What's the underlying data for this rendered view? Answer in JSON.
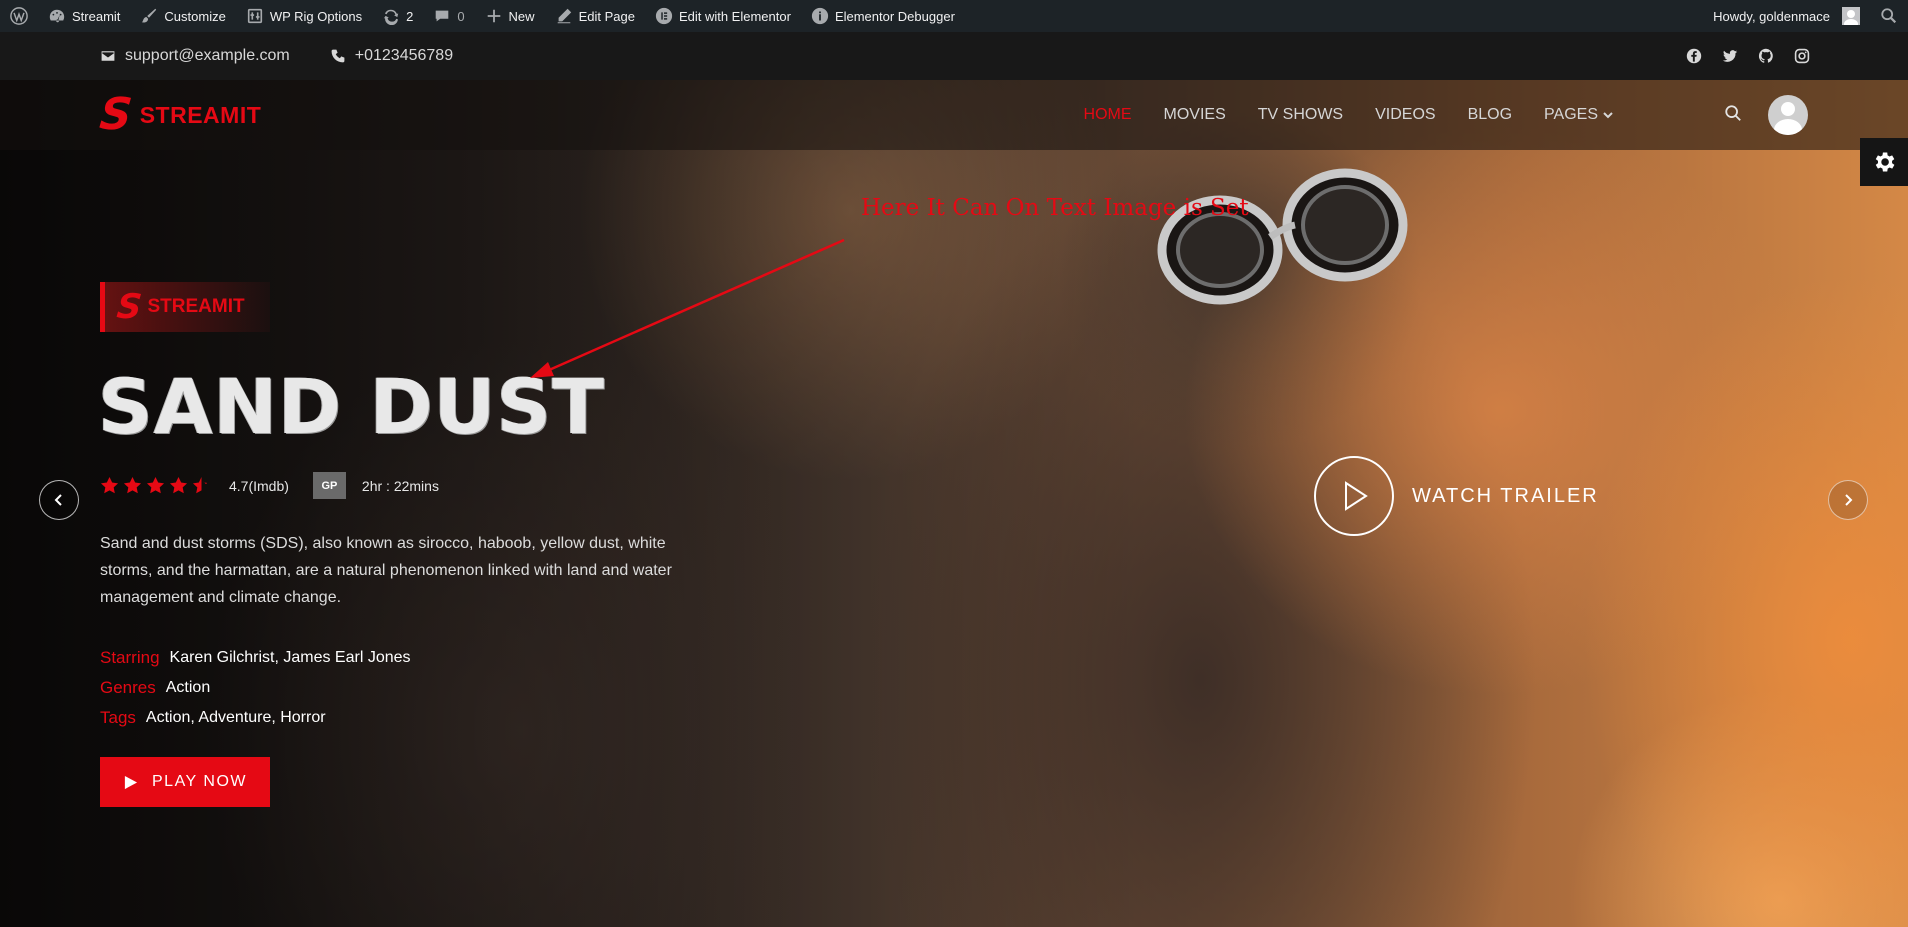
{
  "adminbar": {
    "site_name": "Streamit",
    "customize": "Customize",
    "wp_rig": "WP Rig Options",
    "updates": "2",
    "comments": "0",
    "new": "New",
    "edit_page": "Edit Page",
    "edit_elementor": "Edit with Elementor",
    "debugger": "Elementor Debugger",
    "howdy": "Howdy, goldenmace"
  },
  "topbar": {
    "email": "support@example.com",
    "phone": "+0123456789",
    "social": [
      "facebook-icon",
      "twitter-icon",
      "github-icon",
      "instagram-icon"
    ]
  },
  "header": {
    "logo_text": "STREAMIT",
    "nav": [
      {
        "label": "HOME",
        "active": true
      },
      {
        "label": "MOVIES"
      },
      {
        "label": "TV SHOWS"
      },
      {
        "label": "VIDEOS"
      },
      {
        "label": "BLOG"
      },
      {
        "label": "PAGES"
      }
    ]
  },
  "annotation": "Here It Can On Text Image is Set",
  "hero": {
    "badge_text": "STREAMIT",
    "title": "SAND DUST",
    "rating_stars": 4.5,
    "rating": "4.7(Imdb)",
    "certificate": "GP",
    "duration": "2hr : 22mins",
    "description": "Sand and dust storms (SDS), also known as sirocco, haboob, yellow dust, white storms, and the harmattan, are a natural phenomenon linked with land and water management and climate change.",
    "starring_label": "Starring",
    "starring": "Karen Gilchrist, James Earl Jones",
    "genres_label": "Genres",
    "genres": "Action",
    "tags_label": "Tags",
    "tags": "Action, Adventure, Horror",
    "play_label": "PLAY NOW",
    "watch_label": "WATCH TRAILER"
  },
  "colors": {
    "accent": "#e50914",
    "adminbar": "#1d2327",
    "topbar": "#181818"
  }
}
